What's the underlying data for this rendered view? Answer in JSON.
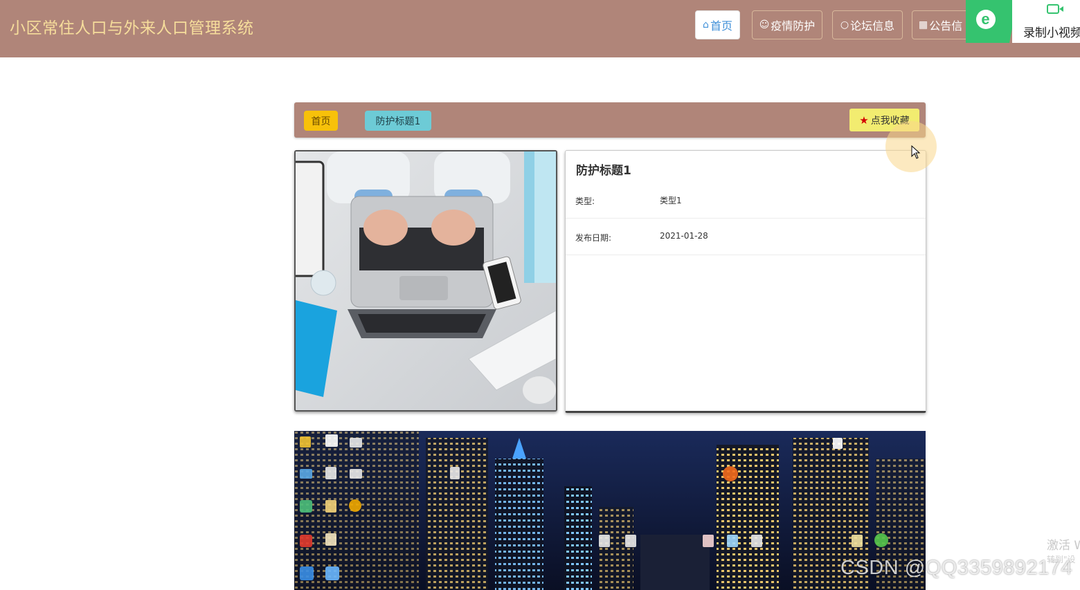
{
  "header": {
    "title": "小区常住人口与外来人口管理系统",
    "nav": [
      {
        "label": "首页",
        "icon": "home-icon"
      },
      {
        "label": "疫情防护",
        "icon": "face-icon"
      },
      {
        "label": "论坛信息",
        "icon": "circle-icon"
      },
      {
        "label": "公告信",
        "icon": "grid-icon"
      }
    ]
  },
  "recorder": {
    "logo": "e",
    "label": "录制小视频"
  },
  "breadcrumb": {
    "home": "首页",
    "current": "防护标题1",
    "favorite": "点我收藏"
  },
  "detail": {
    "title": "防护标题1",
    "rows": [
      {
        "key": "类型:",
        "value": "类型1"
      },
      {
        "key": "发布日期:",
        "value": "2021-01-28"
      }
    ]
  },
  "watermark": {
    "csdn": "CSDN @QQ3359892174",
    "activate": "激活 W",
    "activate_sub": "转到\"设"
  },
  "colors": {
    "header_bg": "#b08579",
    "brand_text": "#f6dd9b",
    "crumb_home_bg": "#f7c10a",
    "crumb_current_bg": "#6dcbd6",
    "favorite_bg": "#f2ec70"
  }
}
